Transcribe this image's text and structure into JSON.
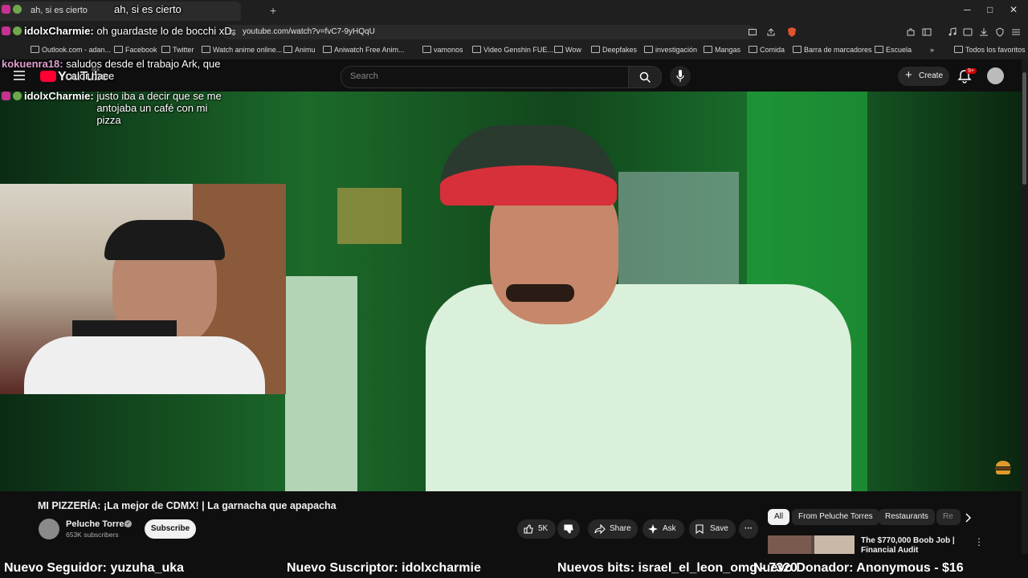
{
  "browser": {
    "tab_title": "ah, si es cierto",
    "new_tab_symbol": "+",
    "window_controls": [
      "─",
      "□",
      "✕"
    ],
    "url": "youtube.com/watch?v=fvC7-9yHQqU",
    "bookmarks": [
      "Outlook.com - adan...",
      "Facebook",
      "Twitter",
      "Watch anime online...",
      "Animu",
      "Aniwatch Free Anim...",
      "vamonos",
      "Video Genshin FUE...",
      "Wow",
      "Deepfakes",
      "investigación",
      "Mangas",
      "Comida",
      "Barra de marcadores",
      "Escuela"
    ],
    "bookmarks_overflow": "»",
    "all_bookmarks": "Todos los favoritos"
  },
  "youtube": {
    "logo_text": "YouTube",
    "logo_region": "MX",
    "search_placeholder": "Search",
    "create_label": "Create",
    "notifications_badge": "9+"
  },
  "video": {
    "title": "MI PIZZERÍA: ¡La mejor de CDMX! | La garnacha que apapacha",
    "channel_name": "Peluche Torres",
    "subscribers": "653K subscribers",
    "subscribe_label": "Subscribe",
    "likes": "5K",
    "share_label": "Share",
    "ask_label": "Ask",
    "save_label": "Save",
    "more_label": "···"
  },
  "chips": [
    "All",
    "From Peluche Torres",
    "Restaurants",
    "Re"
  ],
  "recommendation": {
    "title": "The $770,000 Boob Job | Financial Audit"
  },
  "stream_overlay": {
    "chat": [
      {
        "user": "",
        "message": "ah, si es cierto"
      },
      {
        "user": "idolxCharmie:",
        "message": "oh guardaste lo de bocchi xD"
      },
      {
        "user": "kokuenra18:",
        "message": "saludos desde el trabajo Ark, que calor hace"
      },
      {
        "user": "idolxCharmie:",
        "message": "justo iba a decir que se me antojaba un café con mi pizza"
      }
    ],
    "ticker": [
      "Nuevo Seguidor: yuzuha_uka",
      "Nuevo Suscriptor: idolxcharmie",
      "Nuevos bits: israel_el_leon_omg - 7320",
      "Nuevo Donador: Anonymous - $16"
    ]
  },
  "colors": {
    "youtube_red": "#ff0033",
    "background": "#0f0f0f",
    "chat_badge": "#c5338f"
  }
}
